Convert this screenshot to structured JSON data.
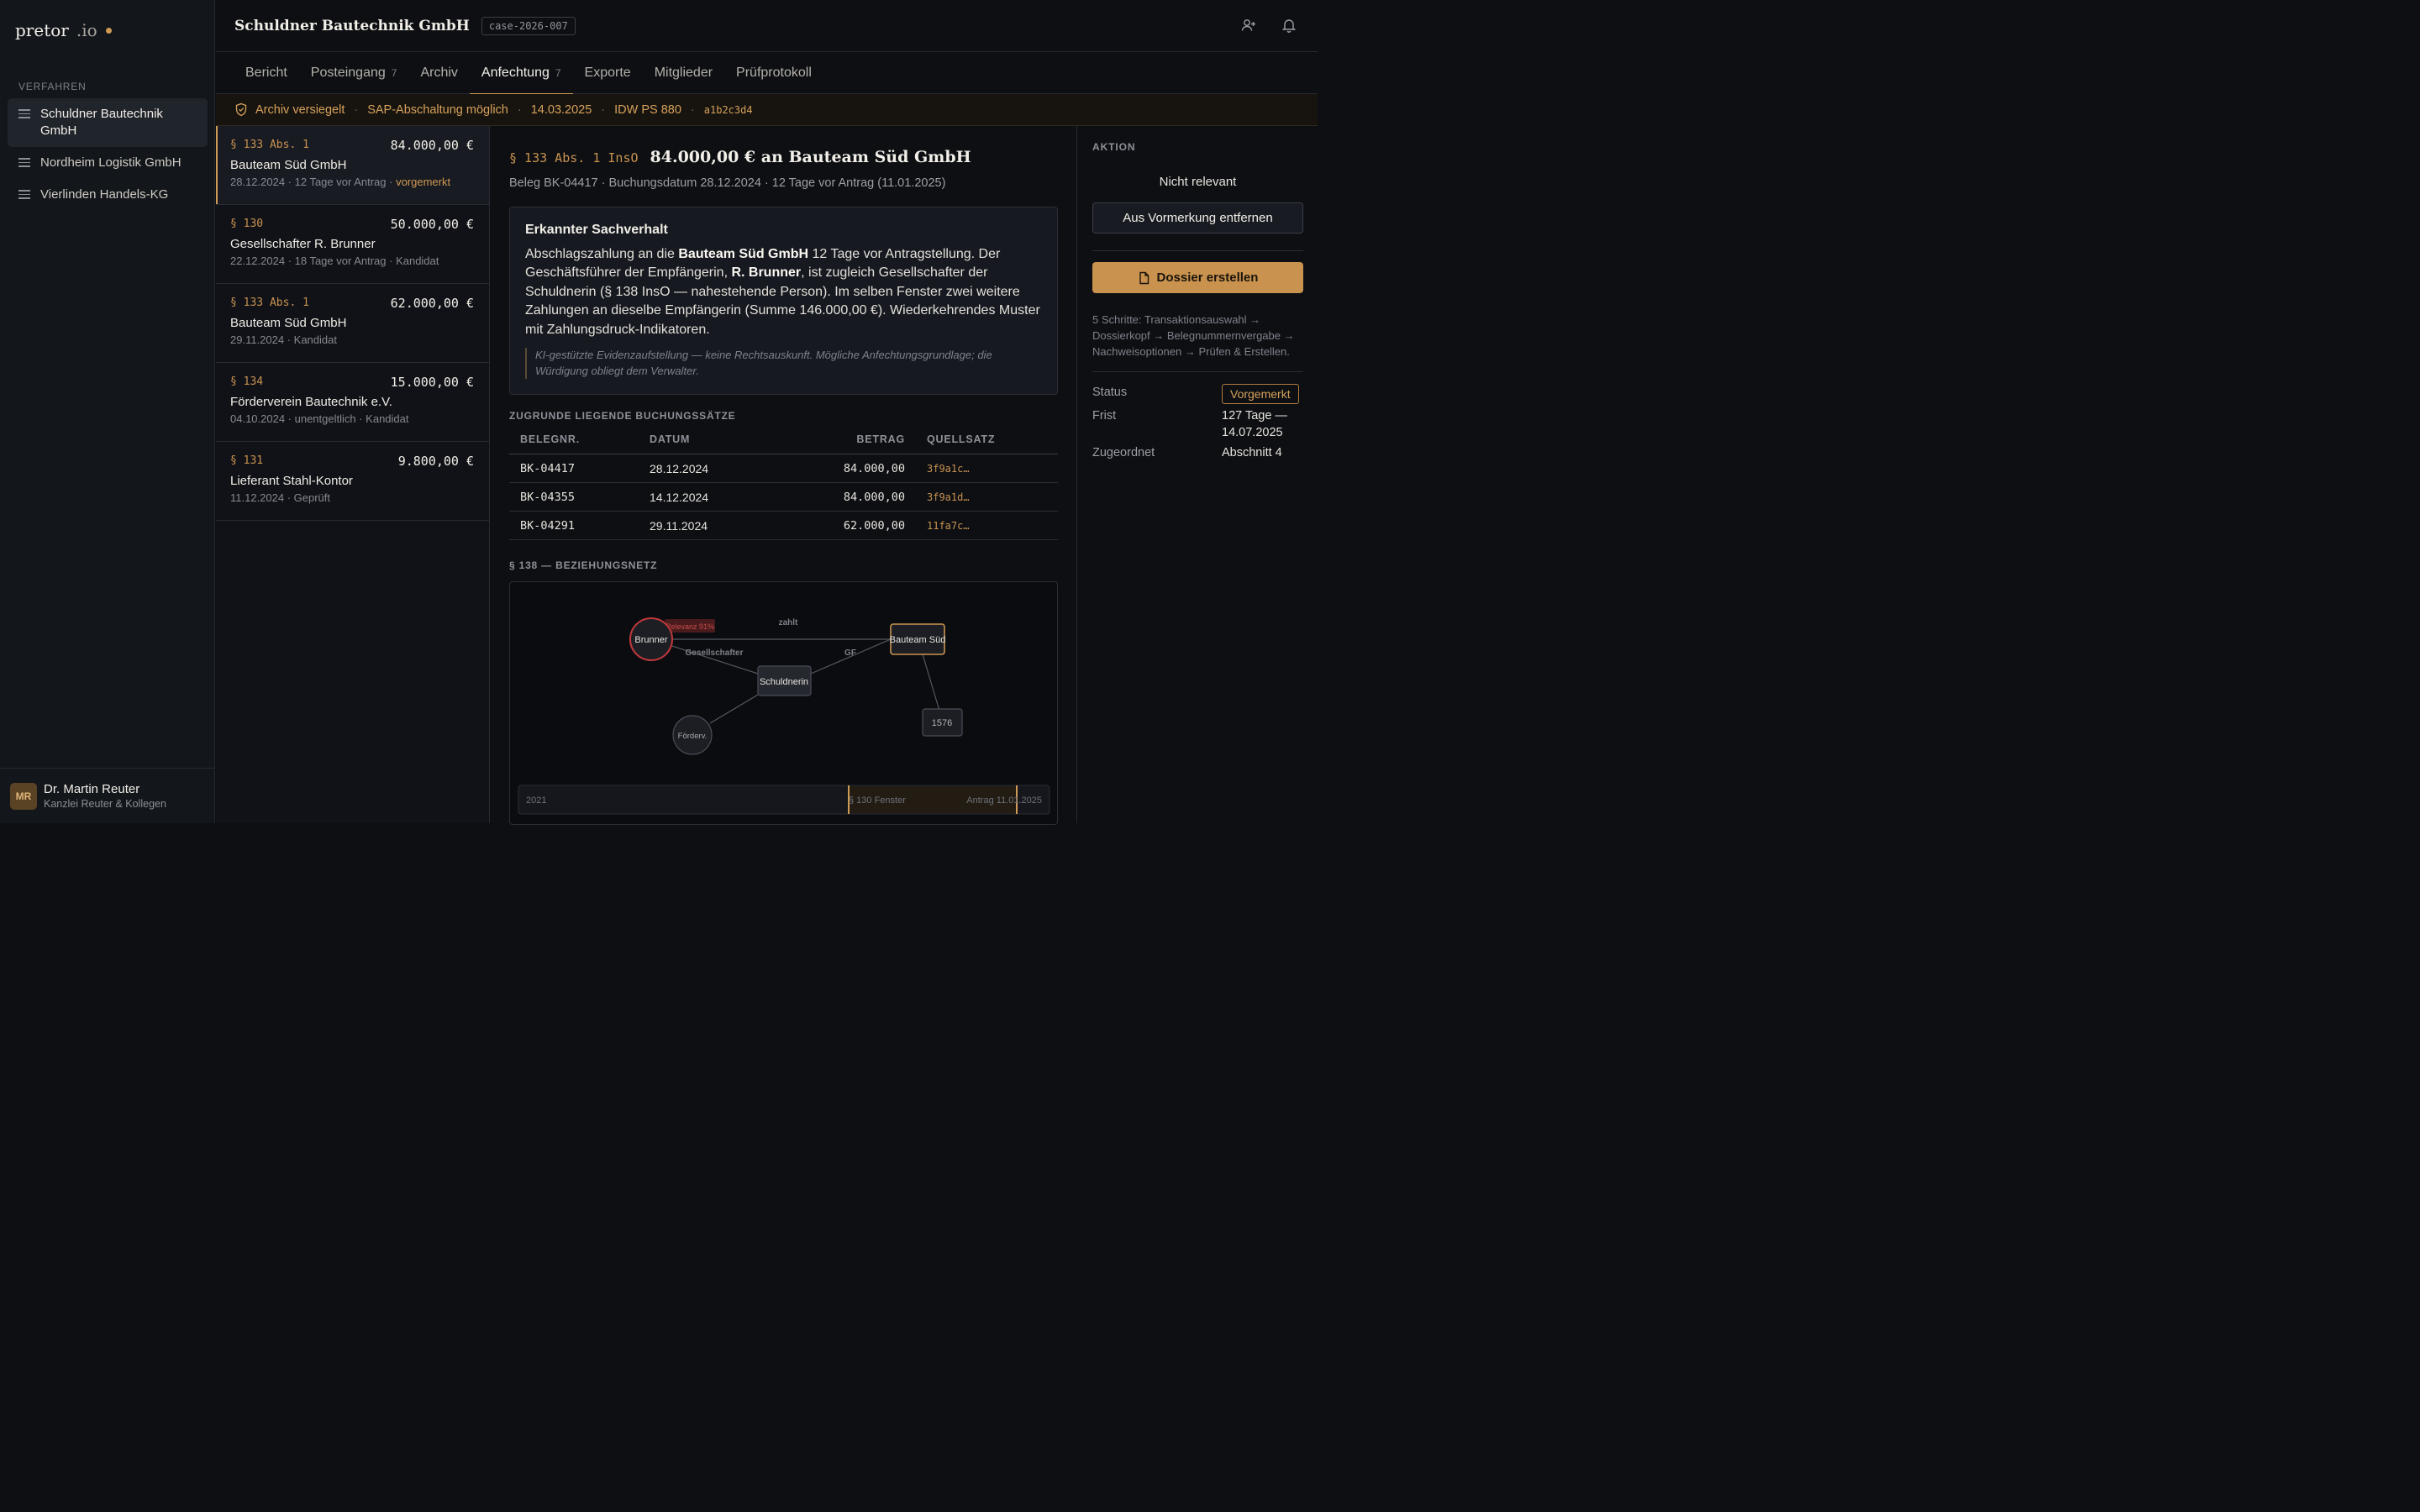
{
  "app": {
    "name": "pretor",
    "tld": ".io"
  },
  "sidebar": {
    "section": "VERFAHREN",
    "items": [
      {
        "label": "Schuldner Bautechnik GmbH"
      },
      {
        "label": "Nordheim Logistik GmbH"
      },
      {
        "label": "Vierlinden Handels-KG"
      }
    ]
  },
  "user": {
    "initials": "MR",
    "name": "Dr. Martin Reuter",
    "org": "Kanzlei Reuter & Kollegen"
  },
  "header": {
    "title": "Schuldner Bautechnik GmbH",
    "case_id": "case-2026-007"
  },
  "tabs": [
    {
      "label": "Bericht",
      "count": ""
    },
    {
      "label": "Posteingang",
      "count": "7"
    },
    {
      "label": "Archiv",
      "count": ""
    },
    {
      "label": "Anfechtung",
      "count": "7"
    },
    {
      "label": "Exporte",
      "count": ""
    },
    {
      "label": "Mitglieder",
      "count": ""
    },
    {
      "label": "Prüfprotokoll",
      "count": ""
    }
  ],
  "strip": {
    "sealed": "Archiv versiegelt",
    "sap": "SAP-Abschaltung möglich",
    "date": "14.03.2025",
    "standard": "IDW PS 880",
    "hash": "a1b2c3d4"
  },
  "list": [
    {
      "para": "§ 133 Abs. 1",
      "amount": "84.000,00 €",
      "name": "Bauteam Süd GmbH",
      "meta": "28.12.2024 · 12 Tage vor Antrag · ",
      "status": "vorgemerkt"
    },
    {
      "para": "§ 130",
      "amount": "50.000,00 €",
      "name": "Gesellschafter R. Brunner",
      "meta": "22.12.2024 · 18 Tage vor Antrag · Kandidat",
      "status": ""
    },
    {
      "para": "§ 133 Abs. 1",
      "amount": "62.000,00 €",
      "name": "Bauteam Süd GmbH",
      "meta": "29.11.2024 · Kandidat",
      "status": ""
    },
    {
      "para": "§ 134",
      "amount": "15.000,00 €",
      "name": "Förderverein Bautechnik e.V.",
      "meta": "04.10.2024 · unentgeltlich · Kandidat",
      "status": ""
    },
    {
      "para": "§ 131",
      "amount": "9.800,00 €",
      "name": "Lieferant Stahl-Kontor",
      "meta": "11.12.2024 · Geprüft",
      "status": ""
    }
  ],
  "detail": {
    "para": "§ 133 Abs. 1 InsO",
    "title": "84.000,00 € an Bauteam Süd GmbH",
    "sub": "Beleg BK-04417 · Buchungsdatum 28.12.2024 · 12 Tage vor Antrag (11.01.2025)",
    "card_title": "Erkannter Sachverhalt",
    "body_1": "Abschlagszahlung an die ",
    "body_b1": "Bauteam Süd GmbH",
    "body_2": " 12 Tage vor Antragstellung. Der Geschäftsführer der Empfängerin, ",
    "body_b2": "R. Brunner",
    "body_3": ", ist zugleich Gesellschafter der Schuldnerin (§ 138 InsO — nahestehende Person). Im selben Fenster zwei weitere Zahlungen an dieselbe Empfängerin (Summe 146.000,00 €). Wiederkehrendes Muster mit Zahlungsdruck-Indikatoren.",
    "note": "KI-gestützte Evidenzaufstellung — keine Rechtsauskunft. Mögliche Anfechtungsgrundlage; die Würdigung obliegt dem Verwalter.",
    "table_label": "ZUGRUNDE LIEGENDE BUCHUNGSSÄTZE",
    "columns": [
      "BELEGNR.",
      "DATUM",
      "BETRAG",
      "QUELLSATZ"
    ],
    "rows": [
      [
        "BK-04417",
        "28.12.2024",
        "84.000,00",
        "3f9a1c…"
      ],
      [
        "BK-04355",
        "14.12.2024",
        "84.000,00",
        "3f9a1d…"
      ],
      [
        "BK-04291",
        "29.11.2024",
        "62.000,00",
        "11fa7c…"
      ]
    ],
    "graph_label": "§ 138 — BEZIEHUNGSNETZ",
    "graph": {
      "relevance": "Relevanz 91%",
      "nodes": {
        "brunner": "Brunner",
        "bauteam": "Bauteam Süd",
        "schuldnerin": "Schuldnerin",
        "foerderv": "Förderv.",
        "n1576": "1576"
      },
      "edges": {
        "zahlt": "zahlt",
        "gesellschafter": "Gesellschafter",
        "gf": "GF"
      },
      "timeline": {
        "start": "2021",
        "window": "§ 130 Fenster",
        "end": "Antrag 11.01.2025"
      }
    }
  },
  "action": {
    "label": "AKTION",
    "not_relevant": "Nicht relevant",
    "remove": "Aus Vormerkung entfernen",
    "create": "Dossier erstellen",
    "steps": "5 Schritte: Transaktionsauswahl → Dossierkopf → Belegnummernvergabe → Nachweisoptionen → Prüfen & Erstellen.",
    "status_k": "Status",
    "status_v": "Vorgemerkt",
    "frist_k": "Frist",
    "frist_v": "127 Tage — 14.07.2025",
    "assigned_k": "Zugeordnet",
    "assigned_v": "Abschnitt 4"
  },
  "colors": {
    "accent": "#c9934f",
    "alert": "#c0393b",
    "background": "#0d0f13"
  },
  "icons": [
    "list-icon",
    "add-user-icon",
    "bell-icon",
    "shield-check-icon",
    "document-icon"
  ]
}
